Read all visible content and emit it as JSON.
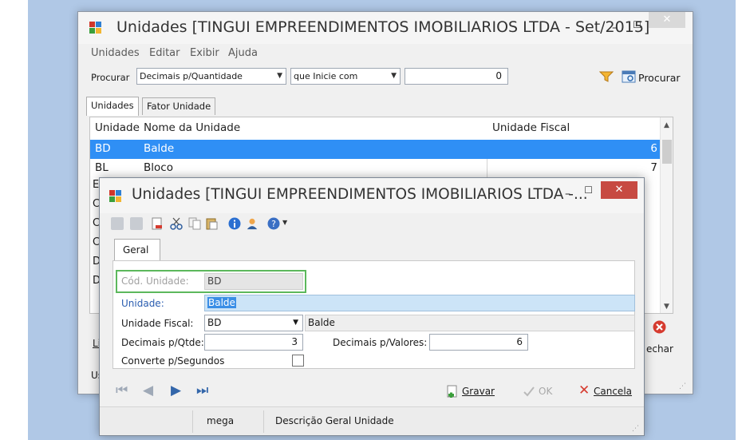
{
  "back_window": {
    "title": "Unidades [TINGUI EMPREENDIMENTOS IMOBILIARIOS LTDA - Set/2015]",
    "minimize": "–",
    "maximize": "☐",
    "close": "✕",
    "menu": [
      "Unidades",
      "Editar",
      "Exibir",
      "Ajuda"
    ],
    "search": {
      "label": "Procurar",
      "field": "Decimais p/Quantidade",
      "mode": "que Inicie com",
      "value": "0",
      "button": "Procurar"
    },
    "tabs": [
      "Unidades",
      "Fator Unidade"
    ],
    "grid": {
      "headers": [
        "Unidade",
        "Nome da Unidade",
        "Unidade Fiscal"
      ],
      "rows": [
        {
          "code": "BD",
          "name": "Balde",
          "fiscal": "6"
        },
        {
          "code": "BL",
          "name": "Bloco",
          "fiscal": "7"
        }
      ],
      "hidden_row_initials": [
        "E",
        "C",
        "C",
        "C",
        "D",
        "D"
      ]
    },
    "bottom_left_label": "Li",
    "status_left": "Us",
    "fechar_label": "echar"
  },
  "dialog": {
    "title": "Unidades [TINGUI EMPREENDIMENTOS IMOBILIARIOS LTDA -...",
    "minimize": "–",
    "maximize": "☐",
    "close": "✕",
    "tab": "Geral",
    "fields": {
      "cod_label": "Cód. Unidade:",
      "cod_value": "BD",
      "unidade_label": "Unidade:",
      "unidade_value": "Balde",
      "fiscal_label": "Unidade Fiscal:",
      "fiscal_value": "BD",
      "fiscal_desc": "Balde",
      "dec_qtde_label": "Decimais p/Qtde:",
      "dec_qtde_value": "3",
      "dec_valores_label": "Decimais p/Valores:",
      "dec_valores_value": "6",
      "converte_label": "Converte p/Segundos"
    },
    "buttons": {
      "gravar": "Gravar",
      "ok": "OK",
      "cancelar": "Cancela"
    },
    "status": {
      "user": "mega",
      "description": "Descrição Geral Unidade"
    }
  },
  "colors": {
    "selection": "#2f8ff5",
    "focus_border": "#5cb85c",
    "edit_highlight": "#cce4f7",
    "link_blue": "#2a5db0"
  }
}
